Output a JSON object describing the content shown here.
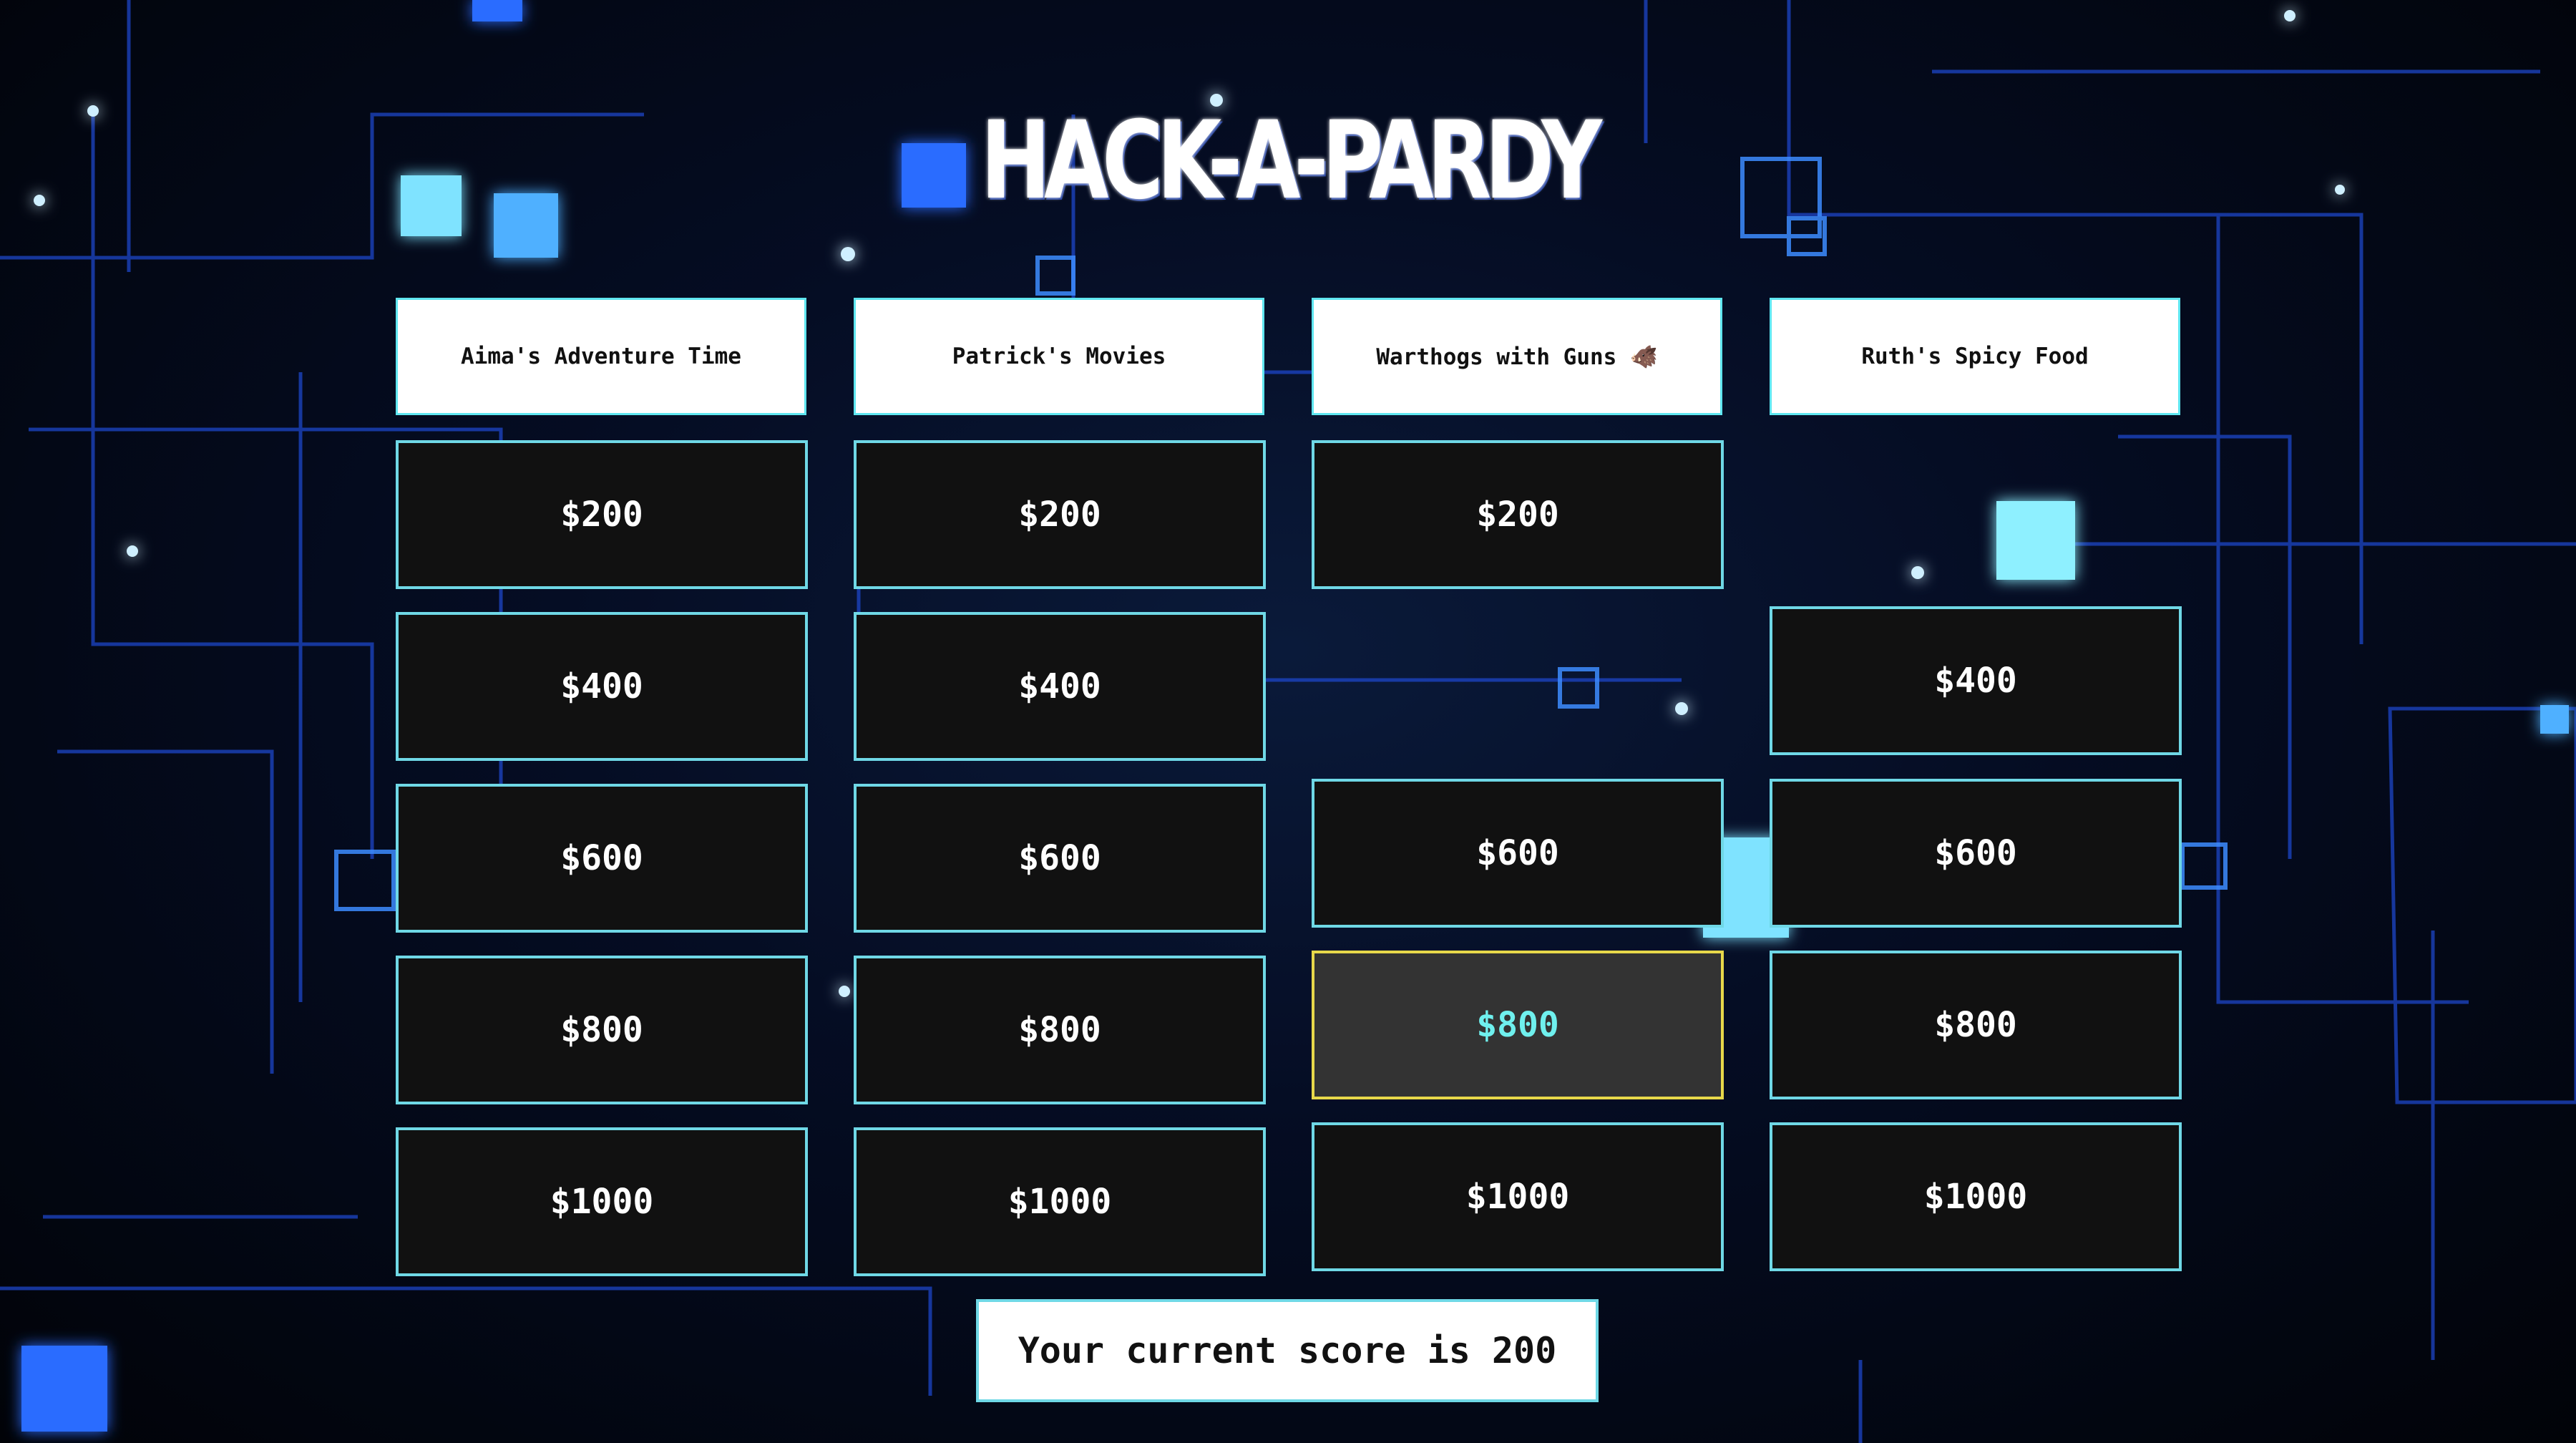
{
  "title": "HACK-A-PARDY",
  "colors": {
    "accent_border": "#6fd8e6",
    "highlight_border": "#e8d84a",
    "highlight_text": "#6ff0ee",
    "cell_bg": "#111111"
  },
  "categories": [
    {
      "name": "Aima's Adventure Time",
      "cells": [
        "$200",
        "$400",
        "$600",
        "$800",
        "$1000"
      ]
    },
    {
      "name": "Patrick's Movies",
      "cells": [
        "$200",
        "$400",
        "$600",
        "$800",
        "$1000"
      ]
    },
    {
      "name": "Warthogs with Guns 🐗",
      "cells": [
        "$200",
        "",
        "$600",
        "$800",
        "$1000"
      ]
    },
    {
      "name": "Ruth's Spicy Food",
      "cells": [
        "",
        "$400",
        "$600",
        "$800",
        "$1000"
      ]
    }
  ],
  "score": {
    "text": "Your current score is 200"
  }
}
